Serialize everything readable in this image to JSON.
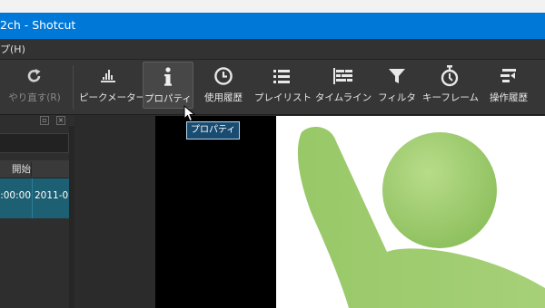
{
  "window": {
    "title": "2ch - Shotcut"
  },
  "menu": {
    "help_label": "プ(H)"
  },
  "toolbar": {
    "items": [
      {
        "label": "やり直す(R)",
        "icon": "redo-icon",
        "enabled": false
      },
      {
        "label": "ピークメーター",
        "icon": "peak-meter-icon"
      },
      {
        "label": "プロパティ",
        "icon": "info-icon",
        "active": true
      },
      {
        "label": "使用履歴",
        "icon": "clock-icon"
      },
      {
        "label": "プレイリスト",
        "icon": "list-icon"
      },
      {
        "label": "タイムライン",
        "icon": "timeline-icon"
      },
      {
        "label": "フィルタ",
        "icon": "filter-icon"
      },
      {
        "label": "キーフレーム",
        "icon": "stopwatch-icon"
      },
      {
        "label": "操作履歴",
        "icon": "history-icon"
      }
    ]
  },
  "tooltip": {
    "text": "プロパティ"
  },
  "playlist": {
    "column_header": "開始",
    "row": {
      "start": ":00:00",
      "date": "2011-0"
    }
  },
  "colors": {
    "titlebar": "#0078d7",
    "selected_row": "#1d5f73",
    "figure_green": "#a3cd72"
  }
}
